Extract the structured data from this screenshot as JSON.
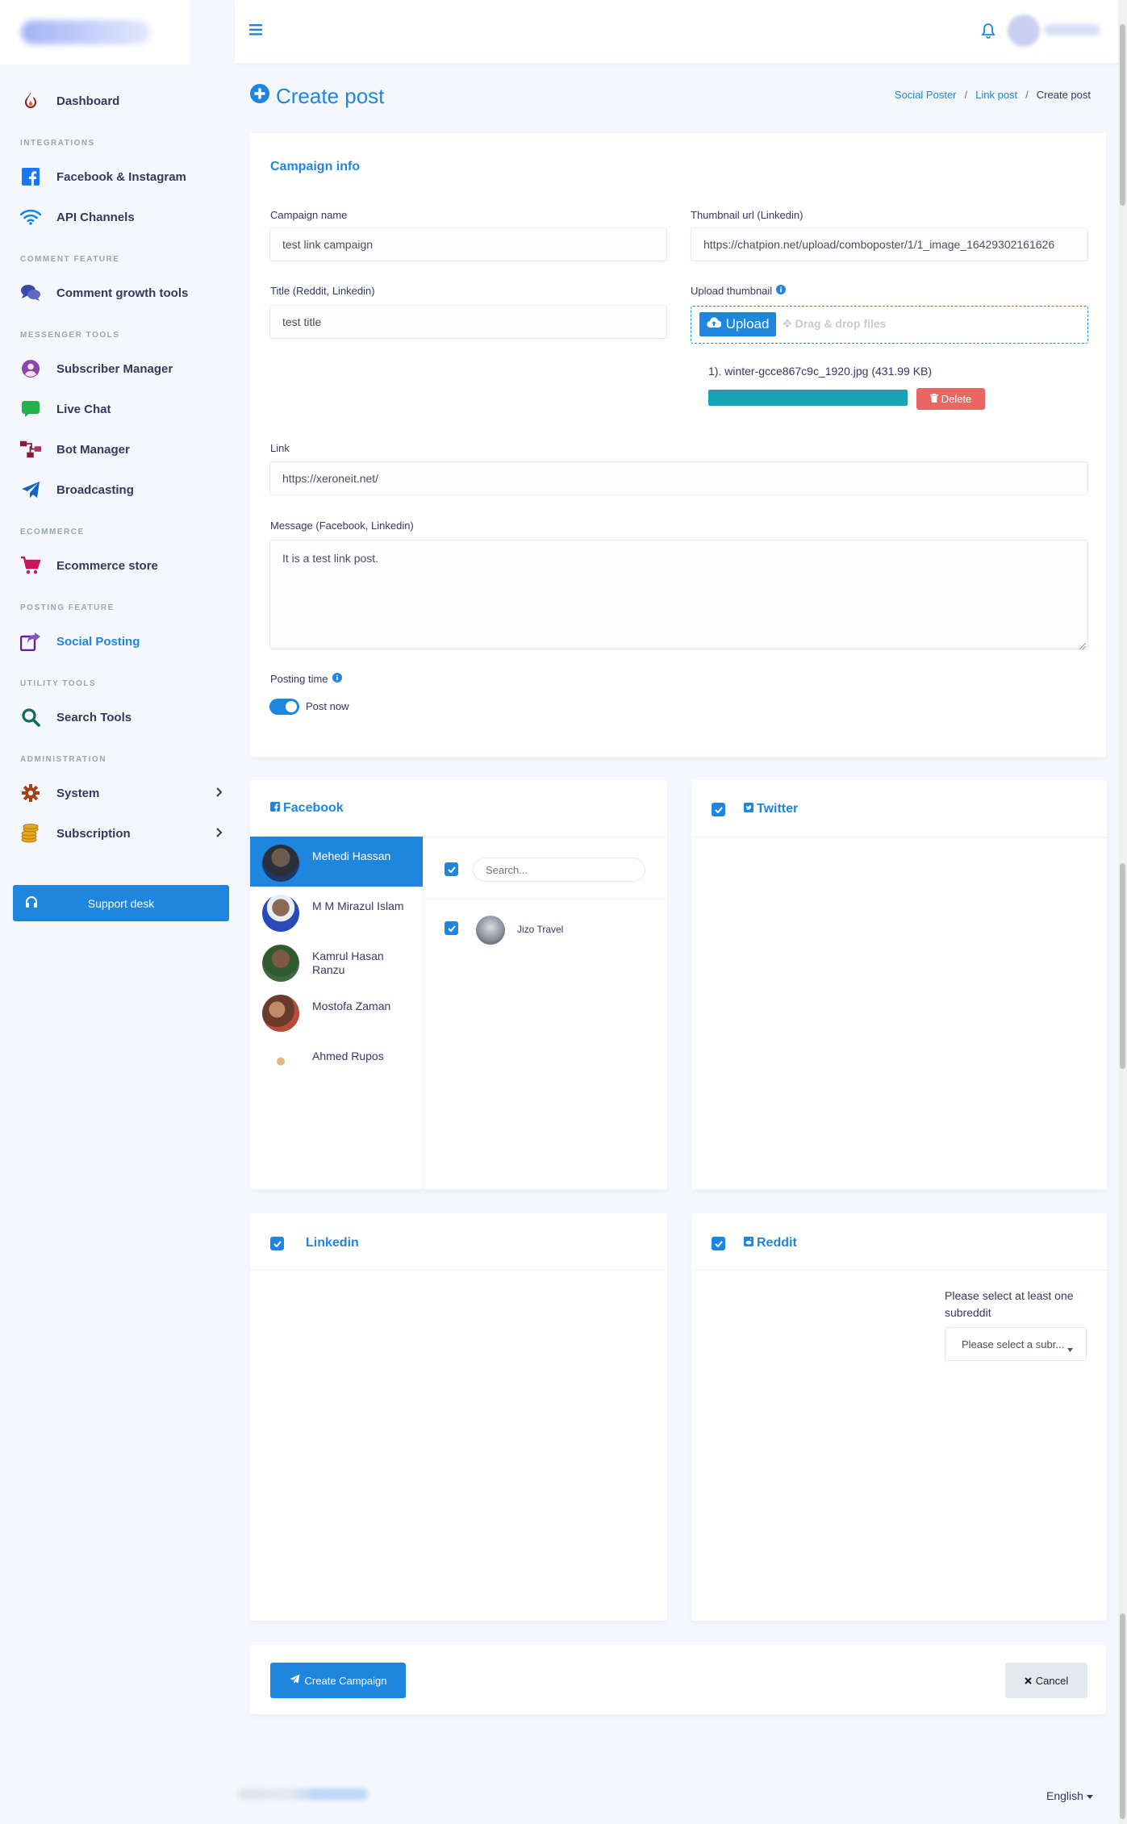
{
  "sidebar": {
    "items": [
      {
        "type": "item",
        "label": "Dashboard",
        "icon": "fire-icon"
      },
      {
        "type": "header",
        "label": "INTEGRATIONS"
      },
      {
        "type": "item",
        "label": "Facebook & Instagram",
        "icon": "facebook-icon"
      },
      {
        "type": "item",
        "label": "API Channels",
        "icon": "wifi-icon"
      },
      {
        "type": "header",
        "label": "COMMENT FEATURE"
      },
      {
        "type": "item",
        "label": "Comment growth tools",
        "icon": "comments-icon"
      },
      {
        "type": "header",
        "label": "MESSENGER TOOLS"
      },
      {
        "type": "item",
        "label": "Subscriber Manager",
        "icon": "user-circle-icon"
      },
      {
        "type": "item",
        "label": "Live Chat",
        "icon": "chat-bubble-icon"
      },
      {
        "type": "item",
        "label": "Bot Manager",
        "icon": "sitemap-icon"
      },
      {
        "type": "item",
        "label": "Broadcasting",
        "icon": "paper-plane-icon"
      },
      {
        "type": "header",
        "label": "ECOMMERCE"
      },
      {
        "type": "item",
        "label": "Ecommerce store",
        "icon": "shopping-cart-icon"
      },
      {
        "type": "header",
        "label": "POSTING FEATURE"
      },
      {
        "type": "item",
        "label": "Social Posting",
        "icon": "share-square-icon",
        "active": true
      },
      {
        "type": "header",
        "label": "UTILITY TOOLS"
      },
      {
        "type": "item",
        "label": "Search Tools",
        "icon": "search-icon"
      },
      {
        "type": "header",
        "label": "ADMINISTRATION"
      },
      {
        "type": "item",
        "label": "System",
        "icon": "cog-icon",
        "arrow": true
      },
      {
        "type": "item",
        "label": "Subscription",
        "icon": "coins-icon",
        "arrow": true
      }
    ],
    "support_label": "Support desk"
  },
  "page": {
    "title": "Create post",
    "breadcrumbs": [
      "Social Poster",
      "Link post",
      "Create post"
    ]
  },
  "campaign": {
    "section_title": "Campaign info",
    "campaign_name_label": "Campaign name",
    "campaign_name_value": "test link campaign",
    "thumb_url_label": "Thumbnail url (Linkedin)",
    "thumb_url_value": "https://chatpion.net/upload/comboposter/1/1_image_16429302161626",
    "title_label": "Title (Reddit, Linkedin)",
    "title_value": "test title",
    "upload_label": "Upload thumbnail",
    "upload_button": "Upload",
    "dragdrop_text": "Drag & drop files",
    "file_name": "1). winter-gcce867c9c_1920.jpg (431.99 KB)",
    "upload_progress": 1.0,
    "delete_label": "Delete",
    "link_label": "Link",
    "link_value": "https://xeroneit.net/",
    "message_label": "Message (Facebook, Linkedin)",
    "message_value": "It is a test link post.",
    "posting_time_label": "Posting time",
    "post_now_label": "Post now"
  },
  "facebook": {
    "title": "Facebook",
    "users": [
      {
        "name": "Mehedi Hassan",
        "selected": true
      },
      {
        "name": "M M Mirazul Islam"
      },
      {
        "name": "Kamrul Hasan Ranzu"
      },
      {
        "name": "Mostofa Zaman"
      },
      {
        "name": "Ahmed Rupos"
      }
    ],
    "search_placeholder": "Search...",
    "pages": [
      {
        "name": "Jizo Travel"
      }
    ]
  },
  "twitter": {
    "title": "Twitter"
  },
  "linkedin": {
    "title": "Linkedin"
  },
  "reddit": {
    "title": "Reddit",
    "hint": "Please select at least one subreddit",
    "select_value": "Please select a subr..."
  },
  "actions": {
    "create_label": "Create Campaign",
    "cancel_label": "Cancel"
  },
  "footer": {
    "language": "English"
  },
  "colors": {
    "primary": "#1f86e0",
    "danger": "#e86763",
    "info": "#17a2b8"
  }
}
